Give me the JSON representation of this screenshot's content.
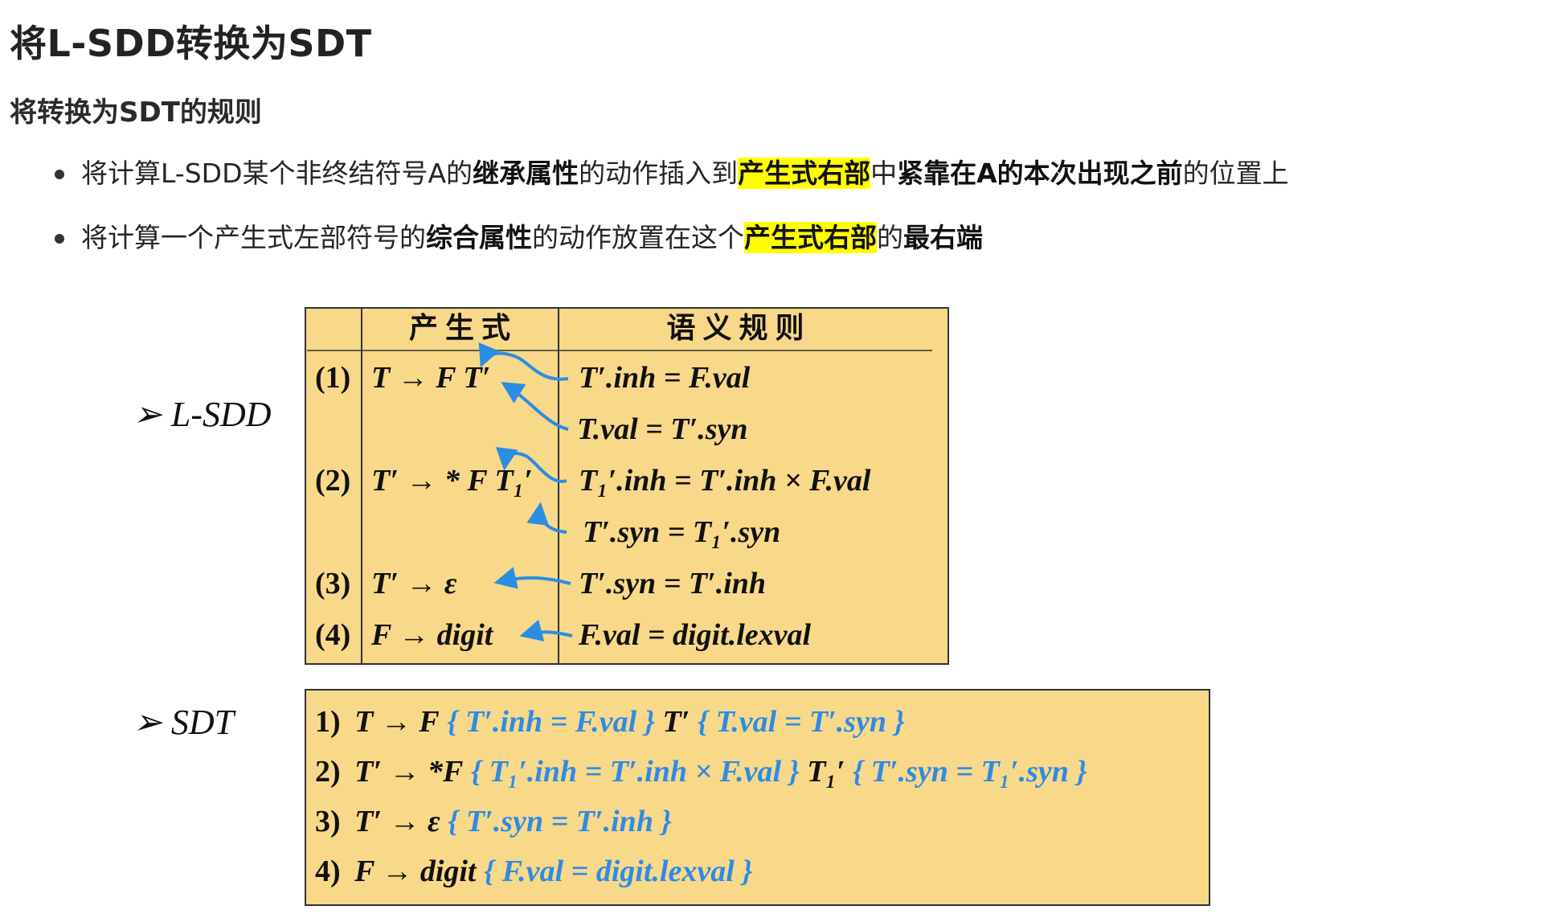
{
  "title": "将L-SDD转换为SDT",
  "subtitle": "将转换为SDT的规则",
  "rules": [
    {
      "parts": [
        {
          "text": "将计算L-SDD某个非终结符号A的",
          "style": "normal"
        },
        {
          "text": "继承属性",
          "style": "bold"
        },
        {
          "text": "的动作插入到",
          "style": "normal"
        },
        {
          "text": "产生式右部",
          "style": "highlight"
        },
        {
          "text": "中",
          "style": "normal"
        },
        {
          "text": "紧靠在A的本次出现之前",
          "style": "bold"
        },
        {
          "text": "的位置上",
          "style": "normal"
        }
      ]
    },
    {
      "parts": [
        {
          "text": "将计算一个产生式左部符号的",
          "style": "normal"
        },
        {
          "text": "综合属性",
          "style": "bold"
        },
        {
          "text": "的动作放置在这个",
          "style": "normal"
        },
        {
          "text": "产生式右部",
          "style": "highlight"
        },
        {
          "text": "的",
          "style": "normal"
        },
        {
          "text": "最右端",
          "style": "bold"
        }
      ]
    }
  ],
  "figure": {
    "lsdd_label": "➢ L-SDD",
    "sdt_label": "➢ SDT",
    "table_headers": {
      "production": "产 生 式",
      "semantic_rules": "语 义 规 则"
    },
    "rows": [
      {
        "num": "(1)",
        "production": "T → F T′",
        "rules": [
          "T′.inh = F.val",
          "T.val = T′.syn"
        ]
      },
      {
        "num": "(2)",
        "production": "T′ → * F T₁′",
        "rules": [
          "T₁′.inh = T′.inh × F.val",
          "T′.syn = T₁′.syn"
        ]
      },
      {
        "num": "(3)",
        "production": "T′ → ε",
        "rules": [
          "T′.syn = T′.inh"
        ]
      },
      {
        "num": "(4)",
        "production": "F → digit",
        "rules": [
          "F.val = digit.lexval"
        ]
      }
    ],
    "sdt_lines": [
      {
        "num": "1)",
        "segments": [
          {
            "t": "T → F",
            "c": "k"
          },
          {
            "t": " { T′.inh = F.val }",
            "c": "b"
          },
          {
            "t": " T′",
            "c": "k"
          },
          {
            "t": " { T.val = T′.syn }",
            "c": "b"
          }
        ]
      },
      {
        "num": "2)",
        "segments": [
          {
            "t": "T′ → *F",
            "c": "k"
          },
          {
            "t": " { T₁′.inh = T′.inh × F.val }",
            "c": "b"
          },
          {
            "t": " T₁′",
            "c": "k"
          },
          {
            "t": " { T′.syn = T₁′.syn }",
            "c": "b"
          }
        ]
      },
      {
        "num": "3)",
        "segments": [
          {
            "t": "T′ → ε",
            "c": "k"
          },
          {
            "t": " { T′.syn = T′.inh }",
            "c": "b"
          }
        ]
      },
      {
        "num": "4)",
        "segments": [
          {
            "t": "F → digit",
            "c": "k"
          },
          {
            "t": " { F.val = digit.lexval }",
            "c": "b"
          }
        ]
      }
    ],
    "colors": {
      "table_bg": "#f8d98a",
      "arrow": "#2b8de3",
      "action_text": "#2e8be6",
      "border": "#333333"
    }
  }
}
